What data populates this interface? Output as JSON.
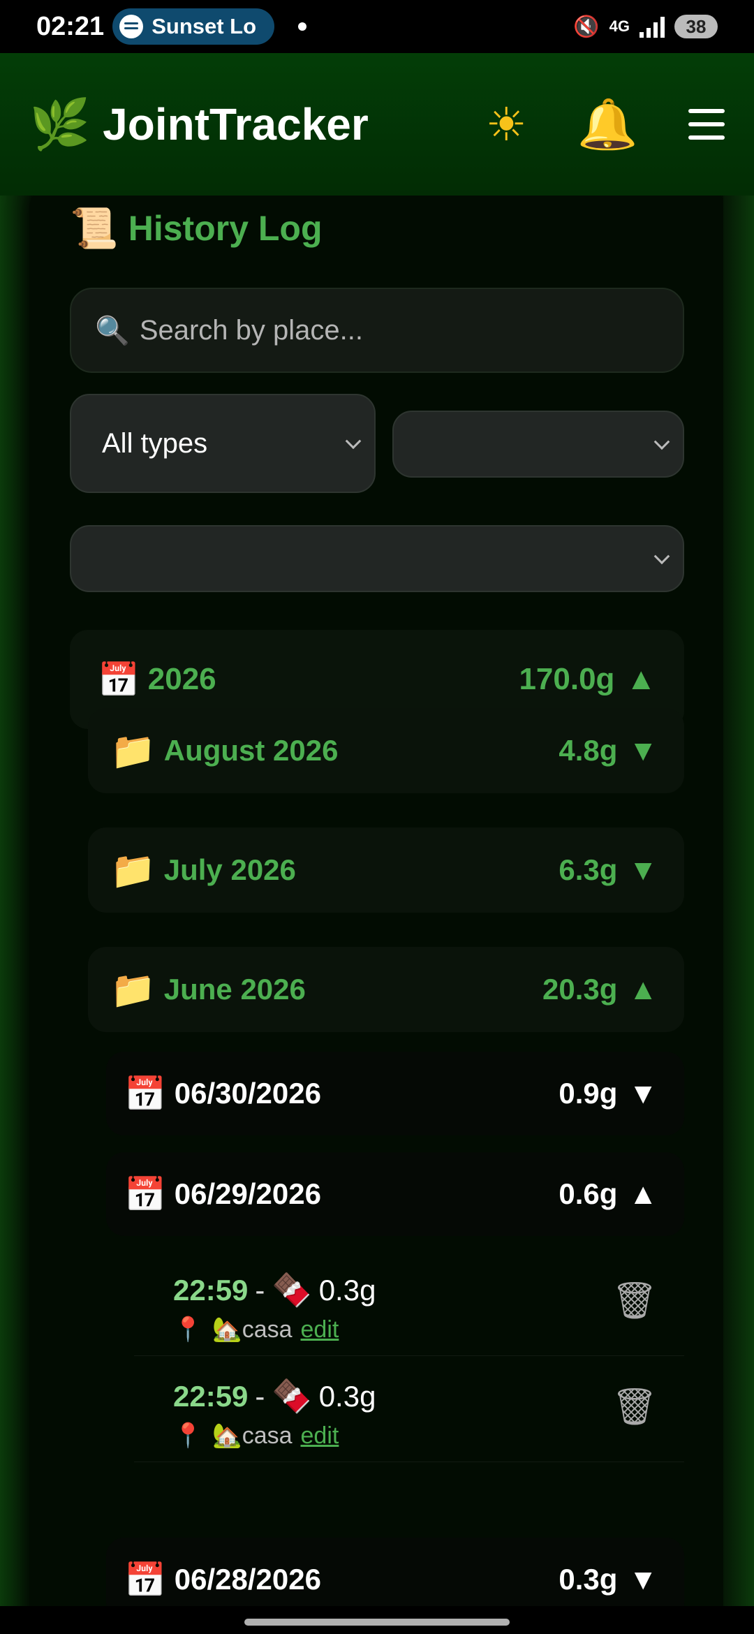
{
  "status_bar": {
    "time": "02:21",
    "media_pill": "Sunset Lo",
    "network": "4G",
    "battery": "38"
  },
  "app": {
    "title": "JointTracker",
    "logo_icon": "🌿",
    "theme_icon": "☀",
    "bell_icon": "🔔"
  },
  "history": {
    "title": "History Log",
    "title_icon": "📜",
    "search": {
      "icon": "🔍",
      "placeholder": "Search by place...",
      "value": ""
    },
    "filters": {
      "type_selected": "All types",
      "second_selected": "",
      "third_selected": ""
    },
    "year": {
      "icon": "📅",
      "label": "2026",
      "total": "170.0g",
      "arrow": "▲"
    },
    "months": [
      {
        "icon": "📁",
        "label": "August 2026",
        "total": "4.8g",
        "arrow": "▼"
      },
      {
        "icon": "📁",
        "label": "July 2026",
        "total": "6.3g",
        "arrow": "▼"
      },
      {
        "icon": "📁",
        "label": "June 2026",
        "total": "20.3g",
        "arrow": "▲"
      }
    ],
    "days": [
      {
        "icon": "📅",
        "label": "06/30/2026",
        "total": "0.9g",
        "arrow": "▼"
      },
      {
        "icon": "📅",
        "label": "06/29/2026",
        "total": "0.6g",
        "arrow": "▲"
      },
      {
        "icon": "📅",
        "label": "06/28/2026",
        "total": "0.3g",
        "arrow": "▼"
      }
    ],
    "entries": [
      {
        "time": "22:59",
        "separator": "-",
        "type_icon": "🍫",
        "amount": "0.3g",
        "pin_icon": "📍",
        "place_icon": "🏡",
        "place": "casa",
        "edit_label": "edit",
        "delete_icon": "🗑"
      },
      {
        "time": "22:59",
        "separator": "-",
        "type_icon": "🍫",
        "amount": "0.3g",
        "pin_icon": "📍",
        "place_icon": "🏡",
        "place": "casa",
        "edit_label": "edit",
        "delete_icon": "🗑"
      }
    ]
  },
  "colors": {
    "accent_green": "#4caf50",
    "appbar_green": "#033d07",
    "time_green": "#8ad88a"
  }
}
